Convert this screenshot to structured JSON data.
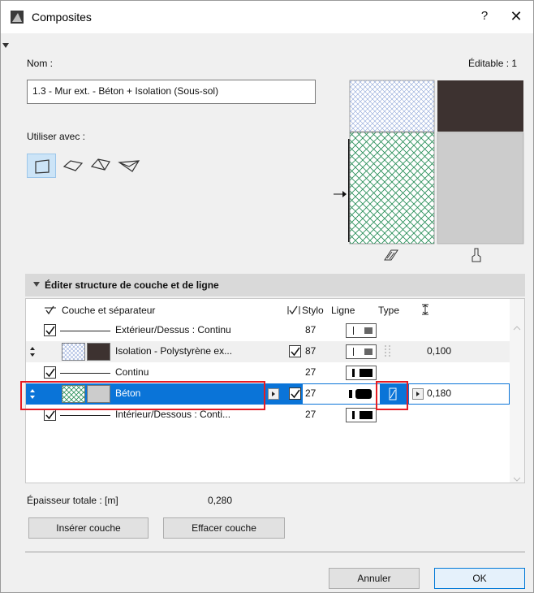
{
  "window": {
    "title": "Composites",
    "help_label": "?",
    "close_label": "✕"
  },
  "labels": {
    "name": "Nom :",
    "editable": "Éditable : 1",
    "use_with": "Utiliser avec :"
  },
  "name_value": "1.3 - Mur ext. - Béton + Isolation (Sous-sol)",
  "use_with_icons": [
    "wall-icon",
    "slab-icon",
    "roof-icon",
    "shell-icon"
  ],
  "preview": {
    "icons": [
      "fill-hatch-icon",
      "brush-icon"
    ]
  },
  "section": {
    "title": "Éditer structure de couche et de ligne"
  },
  "table": {
    "headers": {
      "layer": "Couche et séparateur",
      "pen": "Stylo",
      "line": "Ligne",
      "type": "Type",
      "thickness_icon": "thickness-icon"
    },
    "rows": [
      {
        "kind": "line",
        "label": "Extérieur/Dessus : Continu",
        "pen": "87",
        "checked": true
      },
      {
        "kind": "layer",
        "label": "Isolation - Polystyrène ex...",
        "pen": "87",
        "thickness": "0,100",
        "checked": true
      },
      {
        "kind": "line",
        "label": "Continu",
        "pen": "27",
        "checked": true
      },
      {
        "kind": "layer",
        "label": "Béton",
        "pen": "27",
        "thickness": "0,180",
        "checked": true,
        "selected": true
      },
      {
        "kind": "line",
        "label": "Intérieur/Dessous : Conti...",
        "pen": "27",
        "checked": true
      }
    ]
  },
  "total": {
    "label": "Épaisseur totale : [m]",
    "value": "0,280"
  },
  "buttons": {
    "insert": "Insérer couche",
    "delete": "Effacer couche",
    "cancel": "Annuler",
    "ok": "OK"
  },
  "colors": {
    "selection": "#0a74d8",
    "highlight": "#e51c23",
    "concrete": "#cccccc",
    "dark_fill": "#3d3230",
    "insulation_hatch": "#2a8f5a"
  }
}
